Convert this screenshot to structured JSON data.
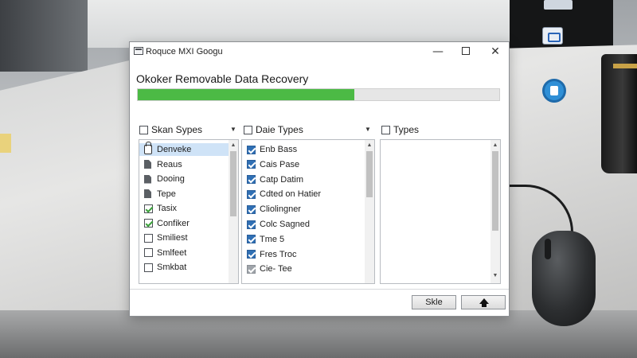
{
  "window": {
    "title": "Roquce MXI  Googu",
    "heading": "Okoker Removable Data Recovery",
    "controls": {
      "minimize": "—",
      "close": "✕"
    }
  },
  "progress": {
    "fraction": 0.6
  },
  "panels": {
    "scan_types": {
      "header": "Skan Sypes",
      "items": [
        {
          "label": "Denveke",
          "icon": "lock-icon",
          "state": "selected"
        },
        {
          "label": "Reaus",
          "icon": "document-icon",
          "state": "none"
        },
        {
          "label": "Dooing",
          "icon": "document-icon",
          "state": "none"
        },
        {
          "label": "Tepe",
          "icon": "document-icon",
          "state": "none"
        },
        {
          "label": "Tasix",
          "icon": "checkbox",
          "state": "checked"
        },
        {
          "label": "Confiker",
          "icon": "checkbox",
          "state": "checked"
        },
        {
          "label": "Smiliest",
          "icon": "checkbox",
          "state": "unchecked"
        },
        {
          "label": "Smlfeet",
          "icon": "checkbox",
          "state": "unchecked"
        },
        {
          "label": "Smkbat",
          "icon": "checkbox",
          "state": "unchecked"
        }
      ]
    },
    "date_types": {
      "header": "Daie Types",
      "items": [
        {
          "label": "Enb Bass",
          "state": "checked"
        },
        {
          "label": "Cais Pase",
          "state": "checked"
        },
        {
          "label": "Catp Datim",
          "state": "checked"
        },
        {
          "label": "Cdted on Hatier",
          "state": "checked"
        },
        {
          "label": "Cliolingner",
          "state": "checked"
        },
        {
          "label": "Colc Sagned",
          "state": "checked"
        },
        {
          "label": "Tme 5",
          "state": "checked"
        },
        {
          "label": "Fres Troc",
          "state": "checked"
        },
        {
          "label": "Cie- Tee",
          "state": "checked-disabled"
        }
      ]
    },
    "types": {
      "header": "Types",
      "items": []
    }
  },
  "buttons": {
    "skip": "Skle",
    "up": ""
  },
  "colors": {
    "accent_green": "#4cba45",
    "check_blue": "#2f6fb4",
    "selection": "#cfe3f7"
  }
}
